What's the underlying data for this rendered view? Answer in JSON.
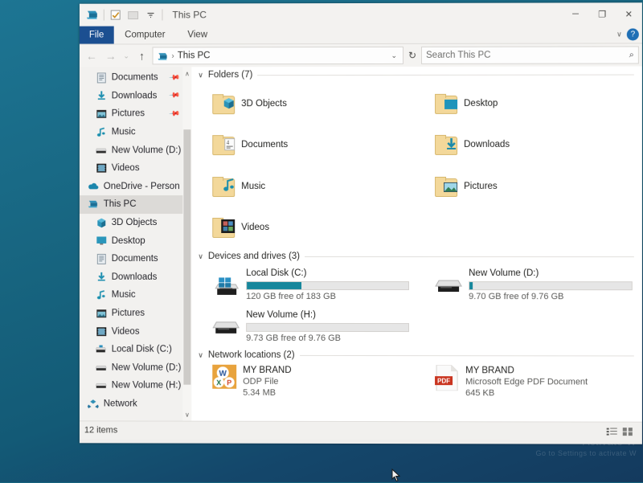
{
  "desktop": {
    "watermark_main": "Activate W",
    "watermark_sub": "Go to Settings to activate W",
    "bg_color": "#17647f"
  },
  "window": {
    "title": "This PC",
    "quick_access": [
      {
        "name": "this-pc-icon",
        "glyph": "■"
      },
      {
        "name": "properties-icon",
        "glyph": "☑"
      },
      {
        "name": "new-folder-icon",
        "glyph": "□"
      },
      {
        "name": "customize-dropdown-icon",
        "glyph": "▾"
      }
    ],
    "controls": {
      "minimize": "─",
      "maximize": "❐",
      "close": "✕",
      "ribbon_collapse": "∨",
      "help": "?"
    }
  },
  "ribbon": {
    "tabs": [
      {
        "label": "File",
        "active": true
      },
      {
        "label": "Computer",
        "active": false
      },
      {
        "label": "View",
        "active": false
      }
    ]
  },
  "address": {
    "back": "←",
    "forward": "→",
    "recent": "⌄",
    "up": "↑",
    "breadcrumb_sep": "›",
    "breadcrumb": "This PC",
    "dropdown": "⌄",
    "refresh": "↻"
  },
  "search": {
    "placeholder": "Search This PC",
    "icon": "⌕"
  },
  "sidebar": {
    "scroll_up": "∧",
    "scroll_down": "∨",
    "items": [
      {
        "label": "Documents",
        "icon": "documents-icon",
        "indent": 1,
        "pinned": true,
        "selected": false
      },
      {
        "label": "Downloads",
        "icon": "downloads-icon",
        "indent": 1,
        "pinned": true,
        "selected": false
      },
      {
        "label": "Pictures",
        "icon": "pictures-icon",
        "indent": 1,
        "pinned": true,
        "selected": false
      },
      {
        "label": "Music",
        "icon": "music-icon",
        "indent": 1,
        "pinned": false,
        "selected": false
      },
      {
        "label": "New Volume (D:)",
        "icon": "drive-icon",
        "indent": 1,
        "pinned": false,
        "selected": false
      },
      {
        "label": "Videos",
        "icon": "videos-icon",
        "indent": 1,
        "pinned": false,
        "selected": false
      },
      {
        "label": "OneDrive - Person",
        "icon": "onedrive-icon",
        "indent": 0,
        "pinned": false,
        "selected": false
      },
      {
        "label": "This PC",
        "icon": "this-pc-icon",
        "indent": 0,
        "pinned": false,
        "selected": true
      },
      {
        "label": "3D Objects",
        "icon": "3d-objects-icon",
        "indent": 1,
        "pinned": false,
        "selected": false
      },
      {
        "label": "Desktop",
        "icon": "desktop-icon",
        "indent": 1,
        "pinned": false,
        "selected": false
      },
      {
        "label": "Documents",
        "icon": "documents-icon",
        "indent": 1,
        "pinned": false,
        "selected": false
      },
      {
        "label": "Downloads",
        "icon": "downloads-icon",
        "indent": 1,
        "pinned": false,
        "selected": false
      },
      {
        "label": "Music",
        "icon": "music-icon",
        "indent": 1,
        "pinned": false,
        "selected": false
      },
      {
        "label": "Pictures",
        "icon": "pictures-icon",
        "indent": 1,
        "pinned": false,
        "selected": false
      },
      {
        "label": "Videos",
        "icon": "videos-icon",
        "indent": 1,
        "pinned": false,
        "selected": false
      },
      {
        "label": "Local Disk (C:)",
        "icon": "local-disk-icon",
        "indent": 1,
        "pinned": false,
        "selected": false
      },
      {
        "label": "New Volume (D:)",
        "icon": "drive-icon",
        "indent": 1,
        "pinned": false,
        "selected": false
      },
      {
        "label": "New Volume (H:)",
        "icon": "drive-icon",
        "indent": 1,
        "pinned": false,
        "selected": false
      },
      {
        "label": "Network",
        "icon": "network-icon",
        "indent": 0,
        "pinned": false,
        "selected": false
      }
    ]
  },
  "content": {
    "groups": [
      {
        "title": "Folders (7)",
        "collapse_icon": "∨"
      },
      {
        "title": "Devices and drives (3)",
        "collapse_icon": "∨"
      },
      {
        "title": "Network locations (2)",
        "collapse_icon": "∨"
      }
    ],
    "folders": [
      {
        "name": "3D Objects",
        "icon": "folder-3d-objects-icon"
      },
      {
        "name": "Desktop",
        "icon": "folder-desktop-icon"
      },
      {
        "name": "Documents",
        "icon": "folder-documents-icon"
      },
      {
        "name": "Downloads",
        "icon": "folder-downloads-icon"
      },
      {
        "name": "Music",
        "icon": "folder-music-icon"
      },
      {
        "name": "Pictures",
        "icon": "folder-pictures-icon"
      },
      {
        "name": "Videos",
        "icon": "folder-videos-icon"
      }
    ],
    "drives": [
      {
        "name": "Local Disk (C:)",
        "free_text": "120 GB free of 183 GB",
        "used_percent": 34,
        "icon": "windows-drive-icon",
        "bar_color": "#17879c"
      },
      {
        "name": "New Volume (D:)",
        "free_text": "9.70 GB free of 9.76 GB",
        "used_percent": 2,
        "icon": "drive-icon",
        "bar_color": "#17879c"
      },
      {
        "name": "New Volume (H:)",
        "free_text": "9.73 GB free of 9.76 GB",
        "used_percent": 0,
        "icon": "drive-icon",
        "bar_color": "#17879c"
      }
    ],
    "network_locations": [
      {
        "name": "MY BRAND",
        "kind": "ODP File",
        "size": "5.34 MB",
        "icon": "office-odp-icon"
      },
      {
        "name": "MY BRAND",
        "kind": "Microsoft Edge PDF Document",
        "size": "645 KB",
        "icon": "pdf-icon",
        "badge": "PDF"
      }
    ]
  },
  "statusbar": {
    "item_count": "12 items",
    "view_details_icon": "≣",
    "view_tiles_icon": "▦"
  }
}
